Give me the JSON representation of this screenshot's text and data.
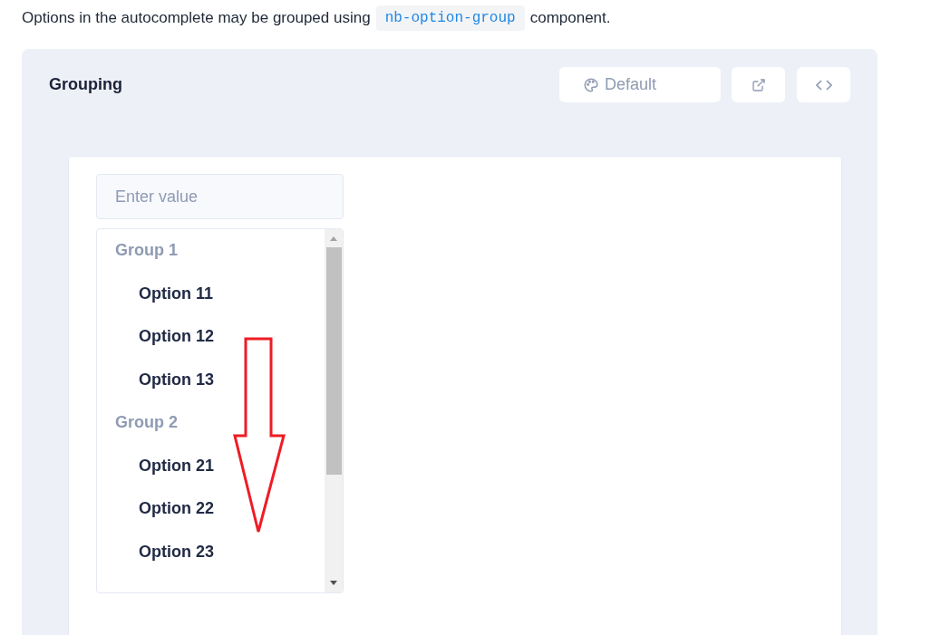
{
  "intro": {
    "before": "Options in the autocomplete may be grouped using",
    "code": "nb-option-group",
    "after": "component."
  },
  "example": {
    "title": "Grouping",
    "theme_button": "Default"
  },
  "autocomplete": {
    "placeholder": "Enter value",
    "groups": [
      {
        "label": "Group 1",
        "options": [
          "Option 11",
          "Option 12",
          "Option 13"
        ]
      },
      {
        "label": "Group 2",
        "options": [
          "Option 21",
          "Option 22",
          "Option 23"
        ]
      }
    ]
  }
}
